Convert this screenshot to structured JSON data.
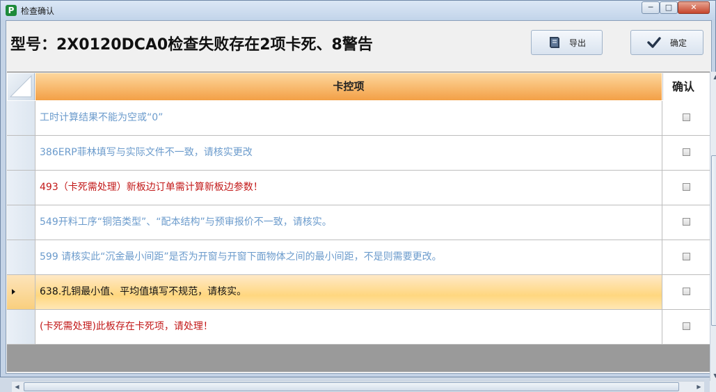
{
  "window": {
    "title": "检查确认",
    "icon": "app-logo-icon",
    "controls": {
      "minimize": "─",
      "maximize": "□",
      "close": "✕"
    }
  },
  "header": {
    "title": "型号：2X0120DCA0检查失败存在2项卡死、8警告",
    "export_label": "导出",
    "export_icon": "book-icon",
    "confirm_label": "确定",
    "confirm_icon": "checkmark-icon"
  },
  "grid": {
    "columns": {
      "main": "卡控项",
      "confirm": "确认"
    },
    "rows": [
      {
        "text": "工时计算结果不能为空或“0”",
        "color": "#6b9bcc",
        "checked": false,
        "selected": false
      },
      {
        "text": "386ERP菲林填写与实际文件不一致，请核实更改",
        "color": "#6b9bcc",
        "checked": false,
        "selected": false
      },
      {
        "text": "493（卡死需处理）新板边订单需计算新板边参数！",
        "color": "#c21818",
        "checked": false,
        "selected": false
      },
      {
        "text": "549开料工序“铜箔类型”、“配本结构”与预审报价不一致，请核实。",
        "color": "#6b9bcc",
        "checked": false,
        "selected": false
      },
      {
        "text": "599 请核实此“沉金最小间距”是否为开窗与开窗下面物体之间的最小间距，不是则需要更改。",
        "color": "#6b9bcc",
        "checked": false,
        "selected": false
      },
      {
        "text": "638.孔铜最小值、平均值填写不规范，请核实。",
        "color": "#111111",
        "checked": false,
        "selected": true
      },
      {
        "text": "(卡死需处理)此板存在卡死项，请处理！",
        "color": "#c21818",
        "checked": false,
        "selected": false
      }
    ]
  },
  "colors": {
    "header_gradient_top": "#fdd79d",
    "header_gradient_bottom": "#f3a046",
    "warning_text": "#6b9bcc",
    "blocking_text": "#c21818"
  }
}
